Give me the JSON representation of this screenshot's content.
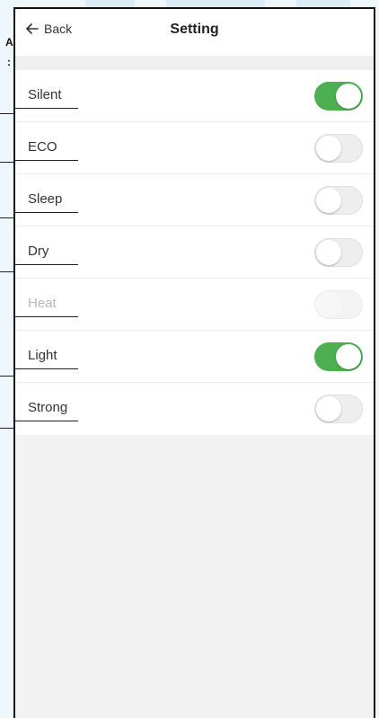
{
  "header": {
    "back_label": "Back",
    "title": "Setting"
  },
  "left_fragments": [
    "A",
    ":"
  ],
  "settings": [
    {
      "label": "Silent",
      "on": true,
      "disabled": false
    },
    {
      "label": "ECO",
      "on": false,
      "disabled": false
    },
    {
      "label": "Sleep",
      "on": false,
      "disabled": false
    },
    {
      "label": "Dry",
      "on": false,
      "disabled": false
    },
    {
      "label": "Heat",
      "on": false,
      "disabled": true
    },
    {
      "label": "Light",
      "on": true,
      "disabled": false
    },
    {
      "label": "Strong",
      "on": false,
      "disabled": false
    }
  ],
  "colors": {
    "toggle_on": "#4caf50",
    "toggle_off": "#eeeeee"
  }
}
